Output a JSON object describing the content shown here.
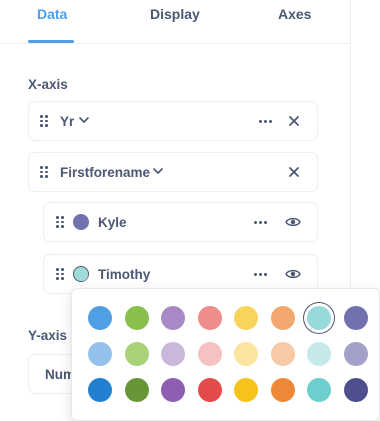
{
  "tabs": [
    {
      "label": "Data",
      "active": true
    },
    {
      "label": "Display",
      "active": false
    },
    {
      "label": "Axes",
      "active": false
    }
  ],
  "x_axis": {
    "label": "X-axis",
    "fields": [
      {
        "label": "Yr"
      },
      {
        "label": "Firstforename"
      }
    ],
    "series": [
      {
        "label": "Kyle",
        "color": "#7172ad"
      },
      {
        "label": "Timothy",
        "color": "#a0dcd7"
      }
    ]
  },
  "y_axis": {
    "label": "Y-axis",
    "field_label_partial": "Num"
  },
  "color_picker": {
    "selected_color": "#a0dcd7",
    "rows": [
      [
        "#509ee3",
        "#88bf4d",
        "#a989c5",
        "#ef8c8c",
        "#f9d45c",
        "#f2a86f",
        "#98d9d9",
        "#7172ad"
      ],
      [
        "#93c1eb",
        "#a9d277",
        "#cab8dc",
        "#f5c1c1",
        "#fbe49d",
        "#f6c9a7",
        "#c5e9ea",
        "#a1a1c9"
      ],
      [
        "#227fd2",
        "#689636",
        "#8e5eb3",
        "#e44a4a",
        "#f7c31a",
        "#ef8738",
        "#6ccfcd",
        "#4f4f8e"
      ]
    ]
  }
}
